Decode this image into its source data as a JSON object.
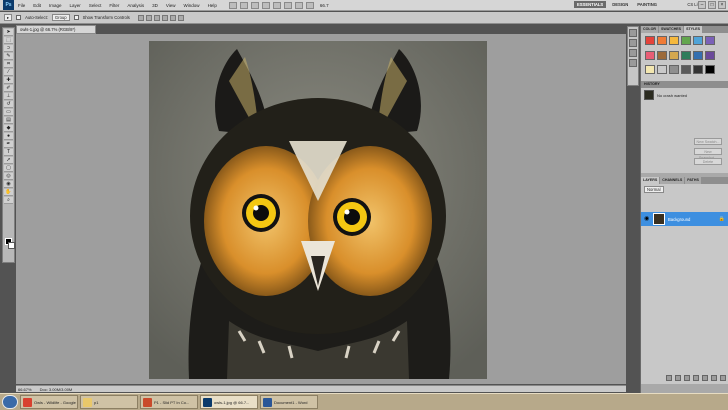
{
  "menubar": {
    "logo": "Ps",
    "items": [
      "File",
      "Edit",
      "Image",
      "Layer",
      "Select",
      "Filter",
      "Analysis",
      "3D",
      "View",
      "Window",
      "Help"
    ],
    "zoom": "66.7",
    "workspaces": [
      "ESSENTIALS",
      "DESIGN",
      "PAINTING"
    ],
    "cs_live": "CS Live"
  },
  "options": {
    "auto_select_label": "Auto-Select:",
    "auto_select_value": "Group",
    "transform_label": "Show Transform Controls"
  },
  "document": {
    "tab_title": "owls-1.jpg @ 66.7% (RGB/8*)",
    "zoom_status": "66.67%",
    "doc_status": "Doc: 3.00M/3.00M"
  },
  "panels": {
    "color_tabs": [
      "COLOR",
      "SWATCHES",
      "STYLES"
    ],
    "history_title": "HISTORY",
    "history_item": "No crash wanted",
    "history_buttons": [
      "New Swatch...",
      "New Snapshot...",
      "Delete"
    ],
    "layers_tabs": [
      "LAYERS",
      "CHANNELS",
      "PATHS"
    ],
    "blend_mode": "Normal",
    "layer_name": "Background"
  },
  "taskbar": {
    "tasks": [
      {
        "label": "Owls - Wildlife - Google",
        "color": "#d8412f"
      },
      {
        "label": "p1",
        "color": "#e9c86a"
      },
      {
        "label": "P1 - Slid PT In Co...",
        "color": "#c94a2b"
      },
      {
        "label": "owls-1.jpg @ 66.7...",
        "color": "#0b3a6b"
      },
      {
        "label": "Document1 - Word",
        "color": "#2b5797"
      }
    ]
  },
  "colors": {
    "accent": "#3d8fe0",
    "swatches": [
      "#e4433b",
      "#f07b36",
      "#f5b93e",
      "#63a64d",
      "#4fa3d8",
      "#7b61b8",
      "#e85d75",
      "#9c6a3a",
      "#d4a84f",
      "#2f7d5b",
      "#356fb0",
      "#6a4a9a",
      "#f3e7b0",
      "#c9c9c9",
      "#8f8f8f",
      "#5a5a5a",
      "#333333",
      "#000000"
    ]
  }
}
